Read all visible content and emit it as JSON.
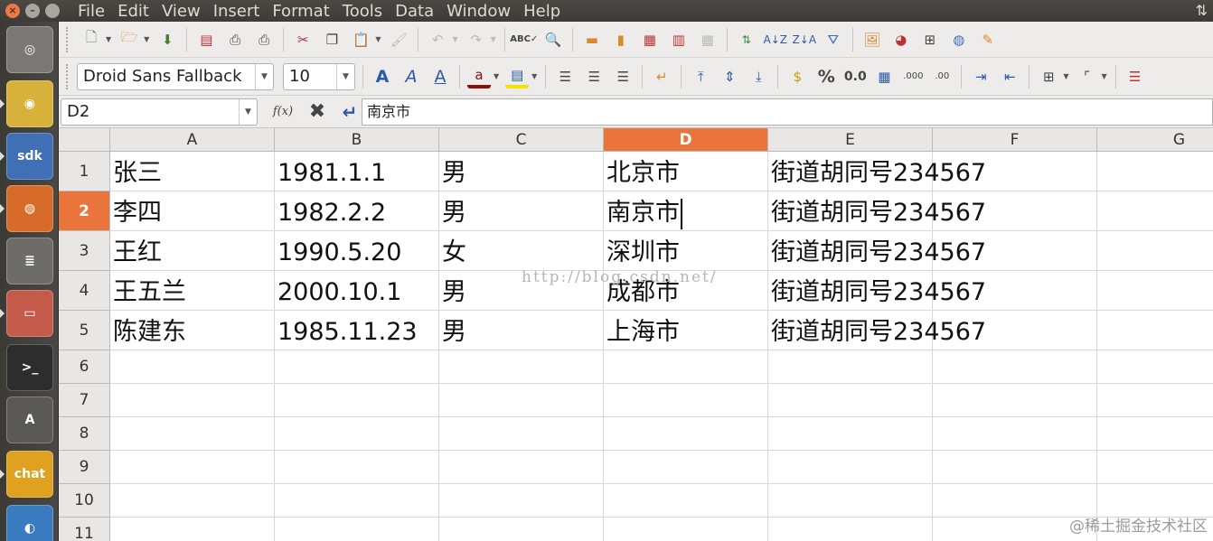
{
  "menubar": {
    "items": [
      "File",
      "Edit",
      "View",
      "Insert",
      "Format",
      "Tools",
      "Data",
      "Window",
      "Help"
    ],
    "right_indicator": "⇅"
  },
  "launcher": {
    "icons": [
      {
        "name": "ubuntu-dash-icon",
        "glyph": "◎",
        "color": "#7a7874"
      },
      {
        "name": "chrome-icon",
        "glyph": "◉",
        "color": "#d8b13a"
      },
      {
        "name": "sdk-manager-icon",
        "glyph": "sdk",
        "color": "#3f6fb5"
      },
      {
        "name": "firefox-icon",
        "glyph": "◍",
        "color": "#d76b2a"
      },
      {
        "name": "archive-manager-icon",
        "glyph": "≣",
        "color": "#6d6c68"
      },
      {
        "name": "file-cabinet-icon",
        "glyph": "▭",
        "color": "#c45b4a"
      },
      {
        "name": "terminal-icon",
        "glyph": ">_",
        "color": "#2d2d2d"
      },
      {
        "name": "software-updater-icon",
        "glyph": "A",
        "color": "#5a5955"
      },
      {
        "name": "chat-app-icon",
        "glyph": "chat",
        "color": "#e0a020"
      },
      {
        "name": "shutter-icon",
        "glyph": "◐",
        "color": "#3a7bbf"
      }
    ]
  },
  "toolbar2": {
    "font_name": "Droid Sans Fallback",
    "font_size": "10",
    "percent_label": "%",
    "decimal_label": "0.0"
  },
  "formula_bar": {
    "name_box": "D2",
    "fx_label": "f(x)",
    "content": "南京市"
  },
  "sheet": {
    "columns": [
      {
        "letter": "A"
      },
      {
        "letter": "B"
      },
      {
        "letter": "C"
      },
      {
        "letter": "D"
      },
      {
        "letter": "E"
      },
      {
        "letter": "F"
      },
      {
        "letter": "G"
      }
    ],
    "selected_column": "D",
    "selected_row": "2",
    "row_numbers": [
      "1",
      "2",
      "3",
      "4",
      "5",
      "6",
      "7",
      "8",
      "9",
      "10",
      "11"
    ],
    "rows": [
      [
        "张三",
        "1981.1.1",
        "男",
        "北京市",
        "街道胡同号234567"
      ],
      [
        "李四",
        "1982.2.2",
        "男",
        "南京市",
        "街道胡同号234567"
      ],
      [
        "王红",
        "1990.5.20",
        "女",
        "深圳市",
        "街道胡同号234567"
      ],
      [
        "王五兰",
        "2000.10.1",
        "男",
        "成都市",
        "街道胡同号234567"
      ],
      [
        "陈建东",
        "1985.11.23",
        "男",
        "上海市",
        "街道胡同号234567"
      ]
    ]
  },
  "watermark": "http://blog.csdn.net/",
  "credit": "@稀土掘金技术社区",
  "colors": {
    "selection_accent": "#e9743c",
    "launcher_bg": "#3c3b37"
  }
}
